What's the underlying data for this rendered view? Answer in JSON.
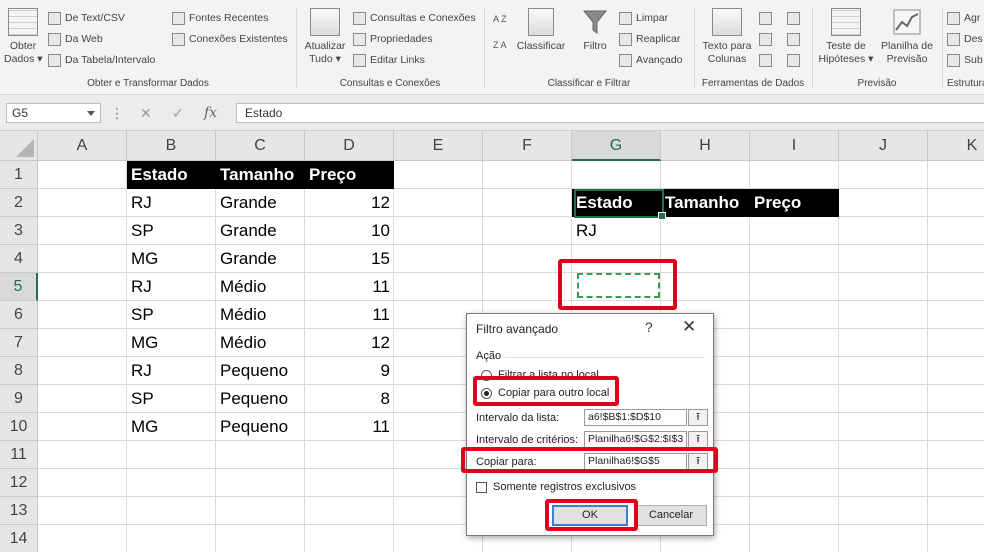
{
  "ribbon": {
    "groups": [
      {
        "title": "Obter e Transformar Dados",
        "big": {
          "label1": "Obter",
          "label2": "Dados ▾"
        },
        "small": [
          "De Text/CSV",
          "Da Web",
          "Da Tabela/Intervalo",
          "Fontes Recentes",
          "Conexões Existentes"
        ]
      },
      {
        "title": "Consultas e Conexões",
        "big": {
          "label1": "Atualizar",
          "label2": "Tudo ▾"
        },
        "small": [
          "Consultas e Conexões",
          "Propriedades",
          "Editar Links"
        ]
      },
      {
        "title": "Classificar e Filtrar",
        "az": "A Z",
        "za": "Z A",
        "big": [
          {
            "label": "Classificar"
          },
          {
            "label": "Filtro"
          }
        ],
        "small": [
          "Limpar",
          "Reaplicar",
          "Avançado"
        ]
      },
      {
        "title": "Ferramentas de Dados",
        "big": {
          "label1": "Texto para",
          "label2": "Colunas"
        }
      },
      {
        "title": "Previsão",
        "big": [
          {
            "label1": "Teste de",
            "label2": "Hipóteses ▾"
          },
          {
            "label1": "Planilha de",
            "label2": "Previsão"
          }
        ]
      },
      {
        "title": "Estrutura",
        "small": [
          "Agr",
          "Des",
          "Sub"
        ]
      }
    ]
  },
  "formula_bar": {
    "name_box": "G5",
    "cancel_glyph": "✕",
    "enter_glyph": "✓",
    "fx_glyph": "fx",
    "dots": "⋮",
    "content": "Estado"
  },
  "sheet": {
    "columns": [
      "A",
      "B",
      "C",
      "D",
      "E",
      "F",
      "G",
      "H",
      "I",
      "J",
      "K"
    ],
    "selected_column": "G",
    "rows": [
      "1",
      "2",
      "3",
      "4",
      "5",
      "6",
      "7",
      "8",
      "9",
      "10",
      "11",
      "12",
      "13",
      "14"
    ],
    "selected_row": "5",
    "table1": {
      "headers": [
        "Estado",
        "Tamanho",
        "Preço"
      ],
      "rows": [
        [
          "RJ",
          "Grande",
          "12"
        ],
        [
          "SP",
          "Grande",
          "10"
        ],
        [
          "MG",
          "Grande",
          "15"
        ],
        [
          "RJ",
          "Médio",
          "11"
        ],
        [
          "SP",
          "Médio",
          "11"
        ],
        [
          "MG",
          "Médio",
          "12"
        ],
        [
          "RJ",
          "Pequeno",
          "9"
        ],
        [
          "SP",
          "Pequeno",
          "8"
        ],
        [
          "MG",
          "Pequeno",
          "11"
        ]
      ]
    },
    "criteria": {
      "headers": [
        "Estado",
        "Tamanho",
        "Preço"
      ],
      "value": "RJ"
    }
  },
  "dialog": {
    "title": "Filtro avançado",
    "help": "?",
    "close": "✕",
    "action_label": "Ação",
    "radio_filter": "Filtrar a lista no local",
    "radio_copy": "Copiar para outro local",
    "list_range_label": "Intervalo da lista:",
    "list_range_value": "a6!$B$1:$D$10",
    "criteria_range_label": "Intervalo de critérios:",
    "criteria_range_value": "Planilha6!$G$2:$I$3",
    "copy_to_label": "Copiar para:",
    "copy_to_value": "Planilha6!$G$5",
    "collapse_glyph": "⭱",
    "unique_label": "Somente registros exclusivos",
    "ok_label": "OK",
    "cancel_label": "Cancelar"
  },
  "colors": {
    "accent_green": "#217346",
    "highlight_red": "#e0001b",
    "header_black": "#000000"
  }
}
